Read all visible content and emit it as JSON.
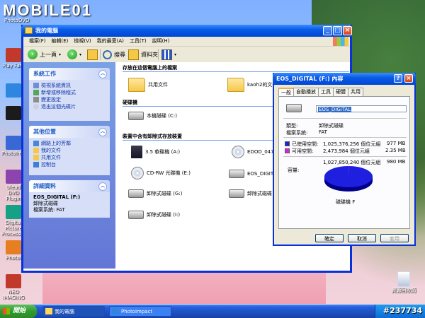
{
  "desktop": {
    "watermark": "MOBILE01",
    "watermark_sub": "PhotoDVD",
    "icons": [
      {
        "label": "PhotoDVD"
      },
      {
        "label": "Play Fam"
      },
      {
        "label": "PhotoImpact"
      },
      {
        "label": "Ulead DVD Plugin"
      },
      {
        "label": "Digital Picture Processing"
      },
      {
        "label": "PhotoI"
      },
      {
        "label": "NEO IMAGING"
      }
    ],
    "recycle_label": "資源回收筒",
    "stamp": "#237734"
  },
  "explorer": {
    "title": "我的電腦",
    "menu": [
      "檔案(F)",
      "編輯(E)",
      "檢視(V)",
      "我的最愛(A)",
      "工具(T)",
      "說明(H)"
    ],
    "toolbar": {
      "back": "上一頁",
      "search": "搜尋",
      "folders": "資料夾"
    },
    "tasks_panel": {
      "title": "系統工作",
      "links": [
        "檢視系統資訊",
        "新增或移除程式",
        "變更設定",
        "退出這個光碟片"
      ]
    },
    "places_panel": {
      "title": "其他位置",
      "links": [
        "網路上的芳鄰",
        "我的文件",
        "共用文件",
        "控制台"
      ]
    },
    "details_panel": {
      "title": "詳細資料",
      "name": "EOS_DIGITAL (F:)",
      "type": "卸除式磁碟",
      "fs": "檔案系統: FAT"
    },
    "groups": {
      "files": "存放在這個電腦上的檔案",
      "hdd": "硬碟機",
      "removable": "裝置中含有卸除式存放裝置"
    },
    "items": {
      "shared_docs": "共用文件",
      "user_docs": "kaoh2的文件",
      "local_c": "本機磁碟 (C:)",
      "floppy": "3.5 軟碟機 (A:)",
      "dvd": "EDOD_047 (D:)",
      "cdrw": "CD-RW 光碟機 (E:)",
      "eos": "EOS_DIGITAL",
      "rem_g": "卸除式磁碟 (G:)",
      "rem_h": "卸除式磁碟 (H:)",
      "rem_i": "卸除式磁碟 (I:)"
    }
  },
  "dialog": {
    "title": "EOS_DIGITAL (F:) 內容",
    "tabs": [
      "一般",
      "自動播放",
      "工具",
      "硬體",
      "共用"
    ],
    "name_value": "EOS_DIGITAL",
    "type_label": "類型:",
    "type_value": "卸除式磁碟",
    "fs_label": "檔案系統:",
    "fs_value": "FAT",
    "used_label": "已使用空間:",
    "used_bytes": "1,025,376,256 個位元組",
    "used_mb": "977 MB",
    "free_label": "可用空間:",
    "free_bytes": "2,473,984 個位元組",
    "free_mb": "2.35 MB",
    "cap_label": "容量:",
    "cap_bytes": "1,027,850,240 個位元組",
    "cap_mb": "980 MB",
    "drive_label": "磁碟機 F",
    "ok": "確定",
    "cancel": "取消",
    "apply": "套用",
    "used_fraction": 0.9976,
    "colors": {
      "used": "#1f1fe0",
      "free": "#e020e0"
    }
  },
  "taskbar": {
    "start": "開始",
    "tasks": [
      "我的電腦",
      "PhotoImpact"
    ]
  }
}
